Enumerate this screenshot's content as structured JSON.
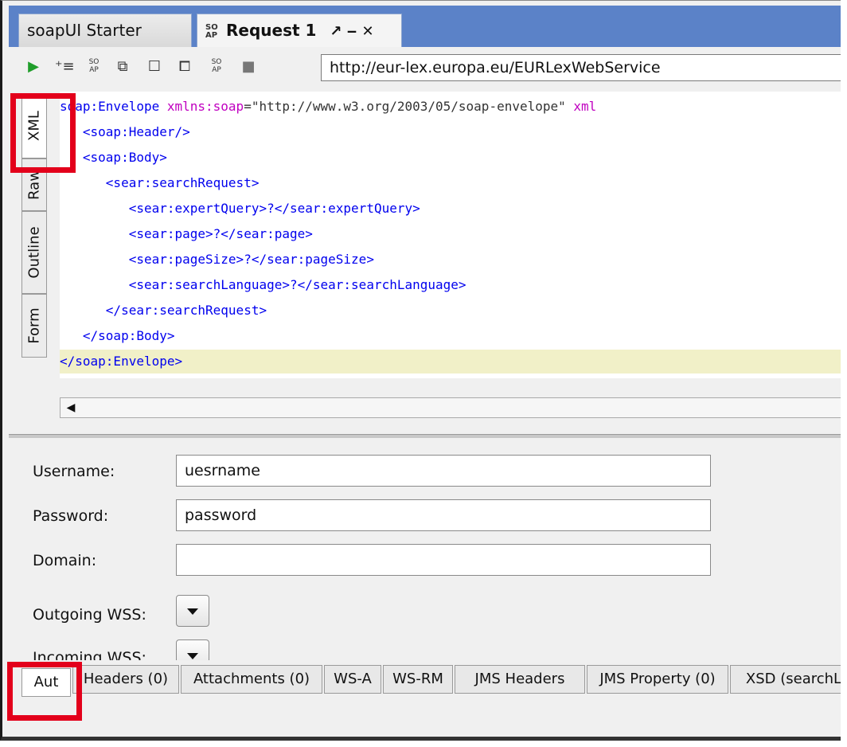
{
  "tabs": [
    {
      "label": "soapUI Starter Page"
    },
    {
      "label": "Request 1",
      "icon_text": "SO AP",
      "controls": "↗ ‒ ✕"
    }
  ],
  "toolbar": {
    "endpoint": "http://eur-lex.europa.eu/EURLexWebService",
    "icons": [
      "play-icon",
      "add-header-icon",
      "soap-icon",
      "format-icon",
      "maximize-icon",
      "tile-icon",
      "soap-icon-2",
      "stop-icon"
    ]
  },
  "editor": {
    "side_tabs": [
      "XML",
      "Raw",
      "Outline",
      "Form"
    ],
    "active_side_tab": "XML",
    "lines": [
      {
        "tag": "soap:Envelope ",
        "attr": "xmlns:soap",
        "str": "=\"http://www.w3.org/2003/05/soap-envelope\" ",
        "attr2": "xml"
      },
      {
        "tag": "   <soap:Header/>"
      },
      {
        "tag": "   <soap:Body>"
      },
      {
        "tag": "      <sear:searchRequest>"
      },
      {
        "tag": "         <sear:expertQuery>?</sear:expertQuery>"
      },
      {
        "tag": "         <sear:page>?</sear:page>"
      },
      {
        "tag": "         <sear:pageSize>?</sear:pageSize>"
      },
      {
        "tag": "         <sear:searchLanguage>?</sear:searchLanguage>"
      },
      {
        "tag": "      </sear:searchRequest>"
      },
      {
        "tag": "   </soap:Body>"
      },
      {
        "tag": "</soap:Envelope>"
      }
    ]
  },
  "auth": {
    "username_label": "Username:",
    "username_value": "uesrname",
    "password_label": "Password:",
    "password_value": "password",
    "domain_label": "Domain:",
    "domain_value": "",
    "outgoing_label": "Outgoing WSS:",
    "incoming_label": "Incoming WSS:"
  },
  "bottom_tabs": [
    "Aut",
    "Headers (0)",
    "Attachments (0)",
    "WS-A",
    "WS-RM",
    "JMS Headers",
    "JMS Property (0)",
    "XSD (searchL"
  ],
  "colors": {
    "highlight": "#e3001b",
    "tabbar": "#5b82c8",
    "xml_tag": "#0000ee",
    "xml_attr": "#c000c0",
    "current_line": "#f1f0c8"
  }
}
